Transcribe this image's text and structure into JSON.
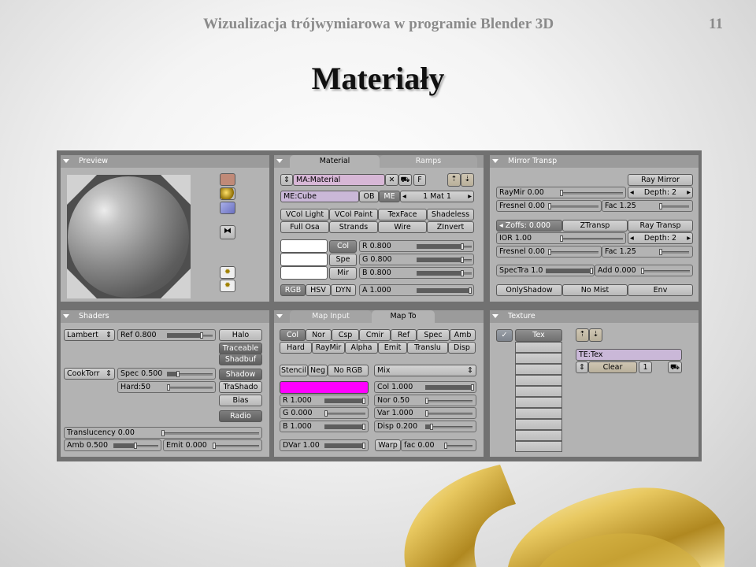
{
  "slide": {
    "header": "Wizualizacja trójwymiarowa w programie Blender 3D",
    "page_number": "11",
    "title": "Materiały"
  },
  "preview": {
    "title": "Preview",
    "icons": [
      "plane-icon",
      "sphere-icon",
      "cube-icon",
      "monkey-icon",
      "light-icon",
      "light-icon"
    ]
  },
  "material_panel": {
    "tabs": [
      "Material",
      "Ramps"
    ],
    "ma_name": "MA:Material",
    "f_label": "F",
    "me_name": "ME:Cube",
    "ob_label": "OB",
    "me_label": "ME",
    "mat_count": "1 Mat 1",
    "row_a": [
      "VCol Light",
      "VCol Paint",
      "TexFace",
      "Shadeless"
    ],
    "row_b": [
      "Full Osa",
      "Strands",
      "Wire",
      "ZInvert"
    ],
    "col_buttons": [
      "Col",
      "Spe",
      "Mir"
    ],
    "rgb_sliders": [
      "R 0.800",
      "G 0.800",
      "B 0.800"
    ],
    "mode_buttons": [
      "RGB",
      "HSV",
      "DYN"
    ],
    "alpha": "A 1.000"
  },
  "mirror_panel": {
    "title": "Mirror Transp",
    "ray_mirror": "Ray Mirror",
    "raymir": "RayMir 0.00",
    "depth1": "Depth: 2",
    "fresnel1": "Fresnel 0.00",
    "fac1": "Fac 1.25",
    "zoffs": "Zoffs: 0.000",
    "ztransp": "ZTransp",
    "ray_transp": "Ray Transp",
    "ior": "IOR 1.00",
    "depth2": "Depth: 2",
    "fresnel2": "Fresnel 0.00",
    "fac2": "Fac 1.25",
    "spectra": "SpecTra 1.0",
    "add": "Add 0.000",
    "only_shadow": "OnlyShadow",
    "no_mist": "No Mist",
    "env": "Env"
  },
  "shaders_panel": {
    "title": "Shaders",
    "diffuse": "Lambert",
    "ref": "Ref  0.800",
    "specular": "CookTorr",
    "spec": "Spec 0.500",
    "hard": "Hard:50",
    "halo": "Halo",
    "traceable": "Traceable",
    "shadbuf": "Shadbuf",
    "shadow": "Shadow",
    "trashado": "TraShado",
    "bias": "Bias",
    "radio": "Radio",
    "translucency": "Translucency 0.00",
    "amb": "Amb 0.500",
    "emit": "Emit 0.000"
  },
  "map_panel": {
    "tabs": [
      "Map Input",
      "Map To"
    ],
    "row1": [
      "Col",
      "Nor",
      "Csp",
      "Cmir",
      "Ref",
      "Spec",
      "Amb"
    ],
    "row2": [
      "Hard",
      "RayMir",
      "Alpha",
      "Emit",
      "Translu",
      "Disp"
    ],
    "stencil": "Stencil",
    "neg": "Neg",
    "no_rgb": "No RGB",
    "blend": "Mix",
    "rgb": [
      "R 1.000",
      "G 0.000",
      "B 1.000"
    ],
    "col": "Col 1.000",
    "nor": "Nor 0.50",
    "var": "Var 1.000",
    "disp": "Disp 0.200",
    "dvar": "DVar 1.00",
    "warp": "Warp",
    "fac": "fac 0.00",
    "color_hex": "#ff00ff"
  },
  "texture_panel": {
    "title": "Texture",
    "tex": "Tex",
    "te_name": "TE:Tex",
    "clear": "Clear",
    "users": "1"
  }
}
